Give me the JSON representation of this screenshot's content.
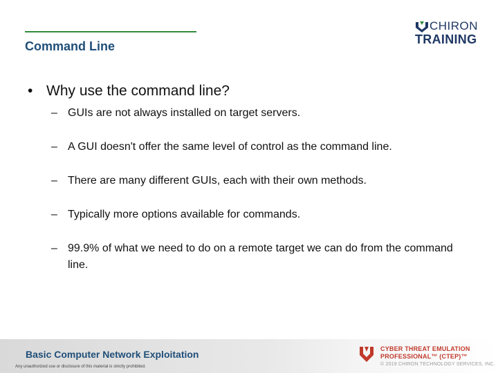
{
  "header": {
    "section_title": "Command Line",
    "logo": {
      "top": "CHIRON",
      "bottom": "TRAINING"
    }
  },
  "content": {
    "main_bullet": "Why use the command line?",
    "sub_items": [
      "GUIs are not always installed on target servers.",
      "A GUI doesn't offer the same level of control as the command line.",
      "There are many different GUIs, each with their own methods.",
      "Typically more options available for commands.",
      "99.9% of what we need to do on a remote target we can do from the command line."
    ],
    "bullet_glyph": "•",
    "dash_glyph": "–"
  },
  "footer": {
    "course_title": "Basic Computer Network Exploitation",
    "disclaimer": "Any unauthorized use or disclosure of this material is strictly prohibited.",
    "ctep_line1": "CYBER THREAT EMULATION",
    "ctep_line2": "PROFESSIONAL™ (CTEP)™",
    "copyright": "© 2019 CHIRON TECHNOLOGY SERVICES, INC."
  },
  "colors": {
    "accent_green": "#2f8a3c",
    "title_blue": "#1f4e79",
    "logo_navy": "#1f3864",
    "ctep_red": "#c0392b"
  }
}
